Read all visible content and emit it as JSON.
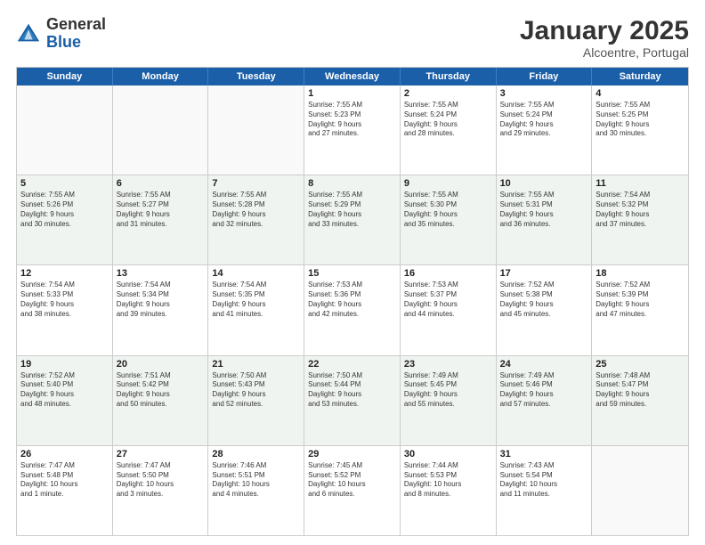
{
  "logo": {
    "general": "General",
    "blue": "Blue"
  },
  "title": "January 2025",
  "subtitle": "Alcoentre, Portugal",
  "weekdays": [
    "Sunday",
    "Monday",
    "Tuesday",
    "Wednesday",
    "Thursday",
    "Friday",
    "Saturday"
  ],
  "rows": [
    [
      {
        "day": "",
        "info": ""
      },
      {
        "day": "",
        "info": ""
      },
      {
        "day": "",
        "info": ""
      },
      {
        "day": "1",
        "info": "Sunrise: 7:55 AM\nSunset: 5:23 PM\nDaylight: 9 hours\nand 27 minutes."
      },
      {
        "day": "2",
        "info": "Sunrise: 7:55 AM\nSunset: 5:24 PM\nDaylight: 9 hours\nand 28 minutes."
      },
      {
        "day": "3",
        "info": "Sunrise: 7:55 AM\nSunset: 5:24 PM\nDaylight: 9 hours\nand 29 minutes."
      },
      {
        "day": "4",
        "info": "Sunrise: 7:55 AM\nSunset: 5:25 PM\nDaylight: 9 hours\nand 30 minutes."
      }
    ],
    [
      {
        "day": "5",
        "info": "Sunrise: 7:55 AM\nSunset: 5:26 PM\nDaylight: 9 hours\nand 30 minutes."
      },
      {
        "day": "6",
        "info": "Sunrise: 7:55 AM\nSunset: 5:27 PM\nDaylight: 9 hours\nand 31 minutes."
      },
      {
        "day": "7",
        "info": "Sunrise: 7:55 AM\nSunset: 5:28 PM\nDaylight: 9 hours\nand 32 minutes."
      },
      {
        "day": "8",
        "info": "Sunrise: 7:55 AM\nSunset: 5:29 PM\nDaylight: 9 hours\nand 33 minutes."
      },
      {
        "day": "9",
        "info": "Sunrise: 7:55 AM\nSunset: 5:30 PM\nDaylight: 9 hours\nand 35 minutes."
      },
      {
        "day": "10",
        "info": "Sunrise: 7:55 AM\nSunset: 5:31 PM\nDaylight: 9 hours\nand 36 minutes."
      },
      {
        "day": "11",
        "info": "Sunrise: 7:54 AM\nSunset: 5:32 PM\nDaylight: 9 hours\nand 37 minutes."
      }
    ],
    [
      {
        "day": "12",
        "info": "Sunrise: 7:54 AM\nSunset: 5:33 PM\nDaylight: 9 hours\nand 38 minutes."
      },
      {
        "day": "13",
        "info": "Sunrise: 7:54 AM\nSunset: 5:34 PM\nDaylight: 9 hours\nand 39 minutes."
      },
      {
        "day": "14",
        "info": "Sunrise: 7:54 AM\nSunset: 5:35 PM\nDaylight: 9 hours\nand 41 minutes."
      },
      {
        "day": "15",
        "info": "Sunrise: 7:53 AM\nSunset: 5:36 PM\nDaylight: 9 hours\nand 42 minutes."
      },
      {
        "day": "16",
        "info": "Sunrise: 7:53 AM\nSunset: 5:37 PM\nDaylight: 9 hours\nand 44 minutes."
      },
      {
        "day": "17",
        "info": "Sunrise: 7:52 AM\nSunset: 5:38 PM\nDaylight: 9 hours\nand 45 minutes."
      },
      {
        "day": "18",
        "info": "Sunrise: 7:52 AM\nSunset: 5:39 PM\nDaylight: 9 hours\nand 47 minutes."
      }
    ],
    [
      {
        "day": "19",
        "info": "Sunrise: 7:52 AM\nSunset: 5:40 PM\nDaylight: 9 hours\nand 48 minutes."
      },
      {
        "day": "20",
        "info": "Sunrise: 7:51 AM\nSunset: 5:42 PM\nDaylight: 9 hours\nand 50 minutes."
      },
      {
        "day": "21",
        "info": "Sunrise: 7:50 AM\nSunset: 5:43 PM\nDaylight: 9 hours\nand 52 minutes."
      },
      {
        "day": "22",
        "info": "Sunrise: 7:50 AM\nSunset: 5:44 PM\nDaylight: 9 hours\nand 53 minutes."
      },
      {
        "day": "23",
        "info": "Sunrise: 7:49 AM\nSunset: 5:45 PM\nDaylight: 9 hours\nand 55 minutes."
      },
      {
        "day": "24",
        "info": "Sunrise: 7:49 AM\nSunset: 5:46 PM\nDaylight: 9 hours\nand 57 minutes."
      },
      {
        "day": "25",
        "info": "Sunrise: 7:48 AM\nSunset: 5:47 PM\nDaylight: 9 hours\nand 59 minutes."
      }
    ],
    [
      {
        "day": "26",
        "info": "Sunrise: 7:47 AM\nSunset: 5:48 PM\nDaylight: 10 hours\nand 1 minute."
      },
      {
        "day": "27",
        "info": "Sunrise: 7:47 AM\nSunset: 5:50 PM\nDaylight: 10 hours\nand 3 minutes."
      },
      {
        "day": "28",
        "info": "Sunrise: 7:46 AM\nSunset: 5:51 PM\nDaylight: 10 hours\nand 4 minutes."
      },
      {
        "day": "29",
        "info": "Sunrise: 7:45 AM\nSunset: 5:52 PM\nDaylight: 10 hours\nand 6 minutes."
      },
      {
        "day": "30",
        "info": "Sunrise: 7:44 AM\nSunset: 5:53 PM\nDaylight: 10 hours\nand 8 minutes."
      },
      {
        "day": "31",
        "info": "Sunrise: 7:43 AM\nSunset: 5:54 PM\nDaylight: 10 hours\nand 11 minutes."
      },
      {
        "day": "",
        "info": ""
      }
    ]
  ]
}
